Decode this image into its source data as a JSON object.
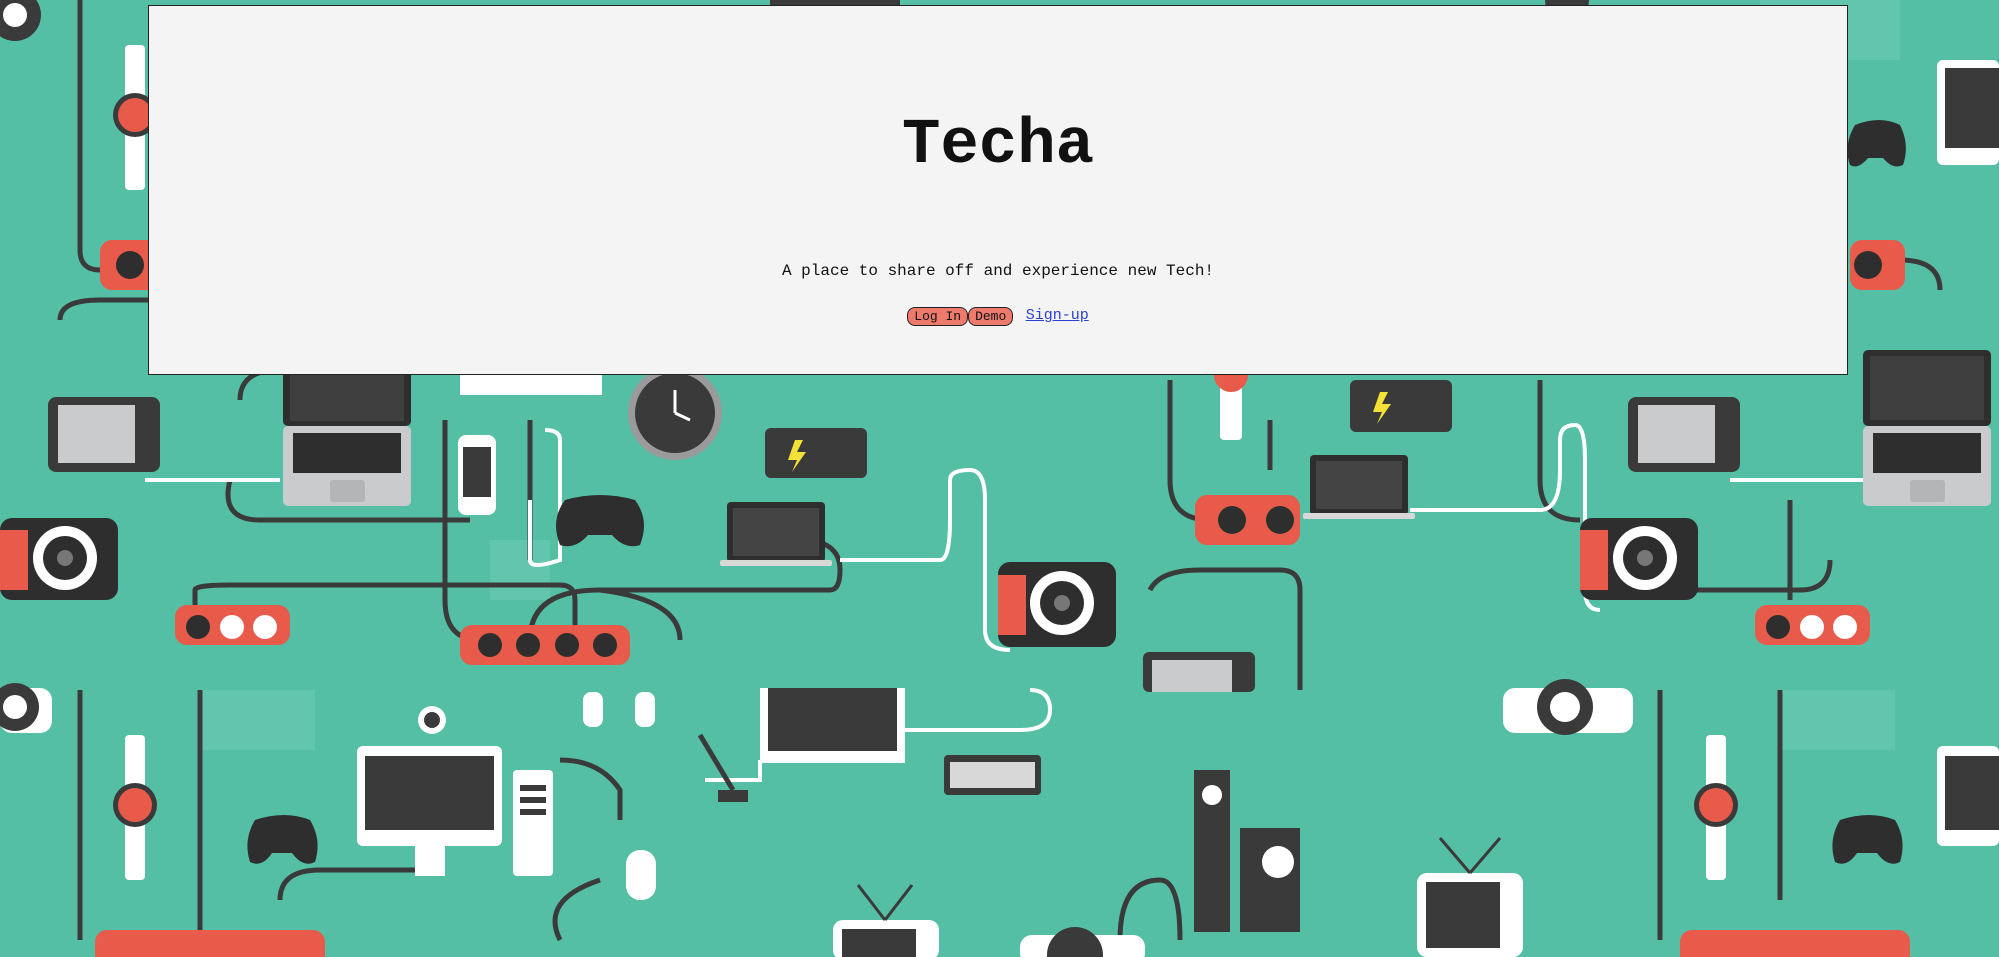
{
  "app": {
    "title": "Techa",
    "tagline": "A place to share off and experience new Tech!"
  },
  "actions": {
    "login_label": "Log In",
    "demo_label": "Demo",
    "signup_label": "Sign-up"
  },
  "colors": {
    "background": "#55bfa6",
    "panel": "#f4f4f4",
    "button": "#ee7a6c",
    "link": "#2b3fd6",
    "accent_red": "#e85a4a",
    "dark_device": "#3a3a3a"
  },
  "background_icons": [
    "watch-icon",
    "power-strip-icon",
    "laptop-icon",
    "tablet-icon",
    "camera-icon",
    "phone-icon",
    "clock-icon",
    "game-controller-icon",
    "battery-icon",
    "monitor-icon",
    "headphones-icon",
    "microphone-icon",
    "keyboard-icon",
    "speaker-icon",
    "tv-icon",
    "mouse-icon",
    "webcam-icon",
    "projector-icon"
  ]
}
